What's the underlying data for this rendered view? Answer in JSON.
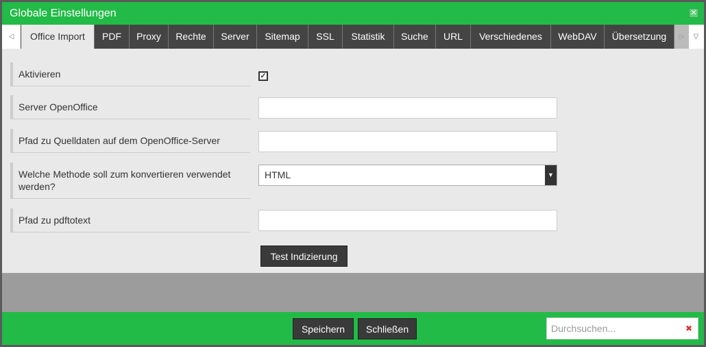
{
  "dialog": {
    "title": "Globale Einstellungen",
    "close_icon": "close-icon"
  },
  "tabs": [
    {
      "label": "Office Import",
      "active": true
    },
    {
      "label": "PDF"
    },
    {
      "label": "Proxy"
    },
    {
      "label": "Rechte"
    },
    {
      "label": "Server"
    },
    {
      "label": "Sitemap"
    },
    {
      "label": "SSL"
    },
    {
      "label": "Statistik"
    },
    {
      "label": "Suche"
    },
    {
      "label": "URL"
    },
    {
      "label": "Verschiedenes"
    },
    {
      "label": "WebDAV"
    },
    {
      "label": "Übersetzung"
    }
  ],
  "form": {
    "aktivieren": {
      "label": "Aktivieren",
      "checked": true
    },
    "server": {
      "label": "Server OpenOffice",
      "value": ""
    },
    "pfad": {
      "label": "Pfad zu Quelldaten auf dem OpenOffice-Server",
      "value": ""
    },
    "methode": {
      "label": "Welche Methode soll zum konvertieren verwendet werden?",
      "value": "HTML"
    },
    "pdftotext": {
      "label": "Pfad zu pdftotext",
      "value": ""
    },
    "test_button": "Test Indizierung"
  },
  "footer": {
    "save": "Speichern",
    "close": "Schließen",
    "search_placeholder": "Durchsuchen..."
  },
  "colors": {
    "header": "#22bb47",
    "tab": "#444444"
  }
}
